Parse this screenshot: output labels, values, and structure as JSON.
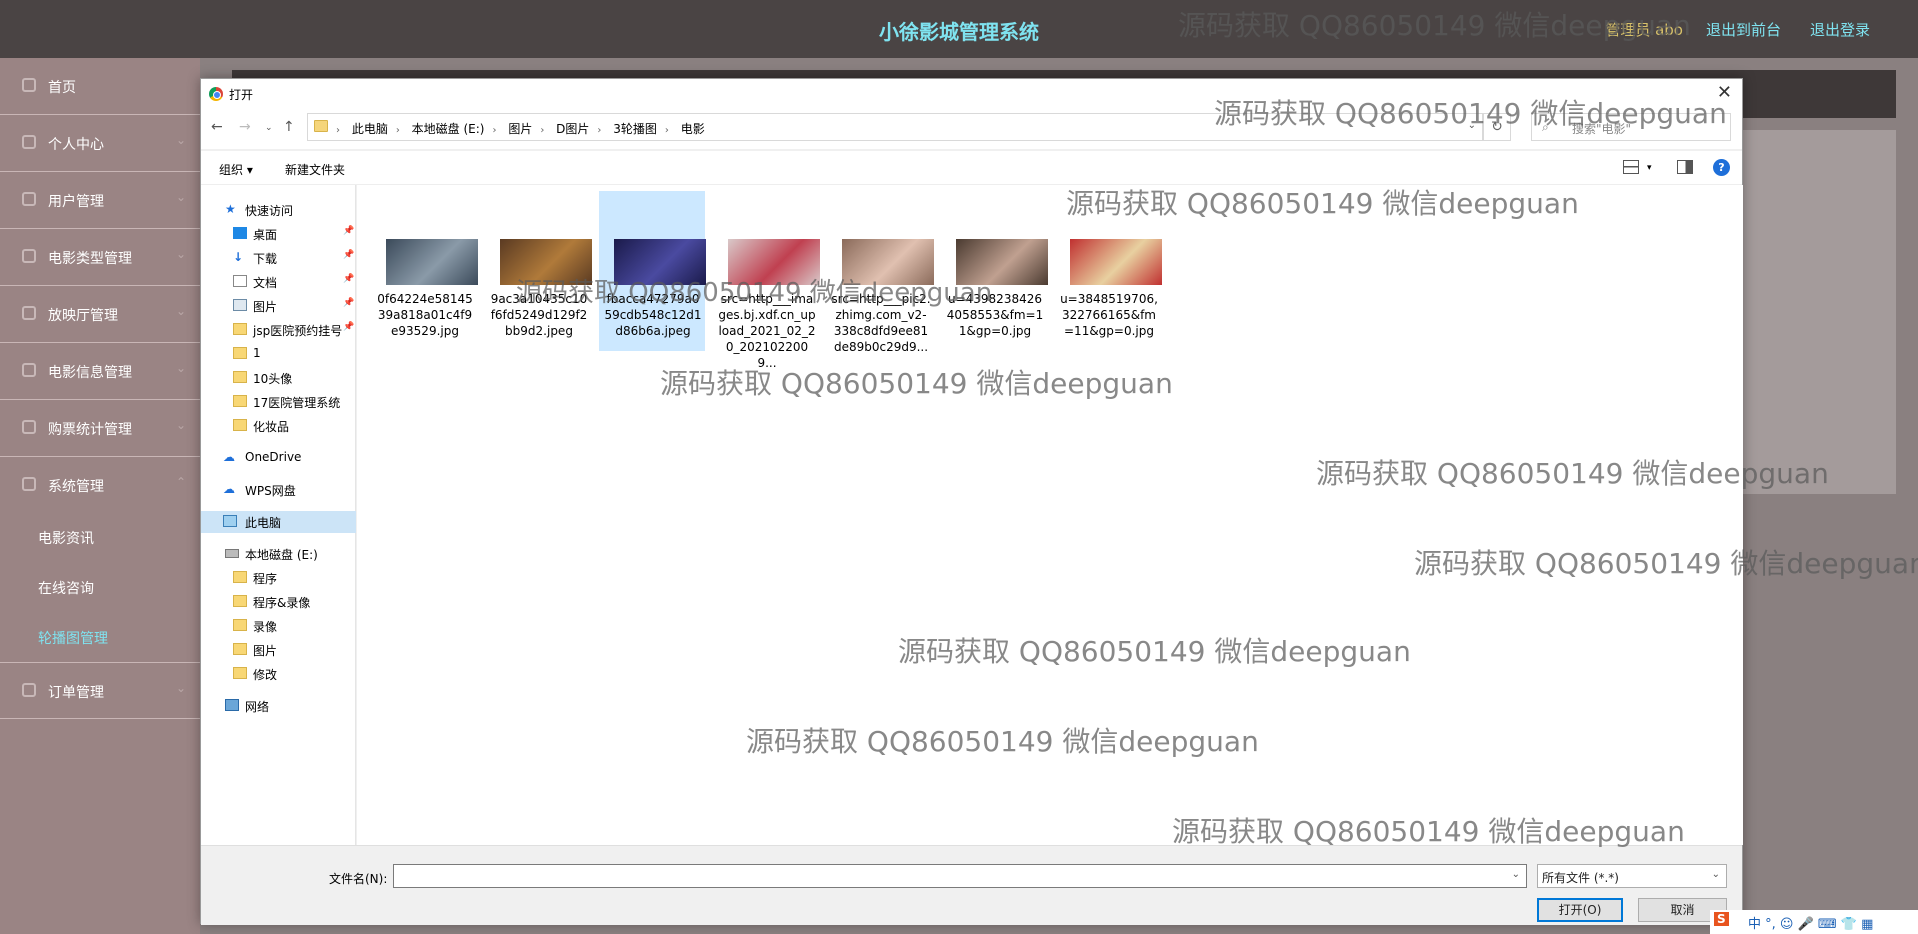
{
  "app": {
    "title": "小徐影城管理系统",
    "user": "管理员 abo",
    "to_front": "退出到前台",
    "logout": "退出登录"
  },
  "sidebar": {
    "items": [
      {
        "label": "首页"
      },
      {
        "label": "个人中心"
      },
      {
        "label": "用户管理"
      },
      {
        "label": "电影类型管理"
      },
      {
        "label": "放映厅管理"
      },
      {
        "label": "电影信息管理"
      },
      {
        "label": "购票统计管理"
      },
      {
        "label": "系统管理"
      }
    ],
    "sub_items": [
      {
        "label": "电影资讯"
      },
      {
        "label": "在线咨询"
      },
      {
        "label": "轮播图管理"
      }
    ],
    "last_item": {
      "label": "订单管理"
    }
  },
  "dialog": {
    "title": "打开",
    "close": "✕",
    "breadcrumb": [
      "此电脑",
      "本地磁盘 (E:)",
      "图片",
      "D图片",
      "3轮播图",
      "电影"
    ],
    "search_placeholder": "搜索\"电影\"",
    "toolbar": {
      "organize": "组织 ▾",
      "new_folder": "新建文件夹"
    },
    "nav_tree": {
      "quick_access": "快速访问",
      "quick_items": [
        "桌面",
        "下载",
        "文档",
        "图片",
        "jsp医院预约挂号",
        "1",
        "10头像",
        "17医院管理系统",
        "化妆品"
      ],
      "onedrive": "OneDrive",
      "wps": "WPS网盘",
      "this_pc": "此电脑",
      "local_disk": "本地磁盘 (E:)",
      "disk_items": [
        "程序",
        "程序&录像",
        "录像",
        "图片",
        "修改"
      ],
      "network": "网络"
    },
    "files": [
      {
        "name": "0f64224e58145 39a818a01c4f9 e93529.jpg",
        "colors": [
          "#3b4a5a",
          "#8a9aa8"
        ]
      },
      {
        "name": "9ac3a10435c10 f6fd5249d129f2 bb9d2.jpeg",
        "colors": [
          "#5a3a22",
          "#b07a3a"
        ]
      },
      {
        "name": "fbacca47279a0 59cdb548c12d1 d86b6a.jpeg",
        "colors": [
          "#1a1a4a",
          "#4a4aa0"
        ]
      },
      {
        "name": "src=http___ima ges.bj.xdf.cn_up load_2021_02_2 0_2021022009...",
        "colors": [
          "#d9c9c9",
          "#c04050"
        ]
      },
      {
        "name": "src=http___pic2. zhimg.com_v2- 338c8dfd9ee81 de89b0c29d9...",
        "colors": [
          "#8a6a5a",
          "#e0c0b0"
        ]
      },
      {
        "name": "u=4398238426 4058553&fm=1 1&gp=0.jpg",
        "colors": [
          "#4a3a30",
          "#c0a090"
        ]
      },
      {
        "name": "u=3848519706, 322766165&fm =11&gp=0.jpg",
        "colors": [
          "#c03030",
          "#e8d0a0"
        ]
      }
    ],
    "filename_label": "文件名(N):",
    "filename_value": "",
    "file_type": "所有文件 (*.*)",
    "open_btn": "打开(O)",
    "cancel_btn": "取消"
  },
  "watermark": "源码获取 QQ86050149 微信deepguan",
  "tray": "中 °,  ☺  🎤  ⌨  👕  ▦"
}
